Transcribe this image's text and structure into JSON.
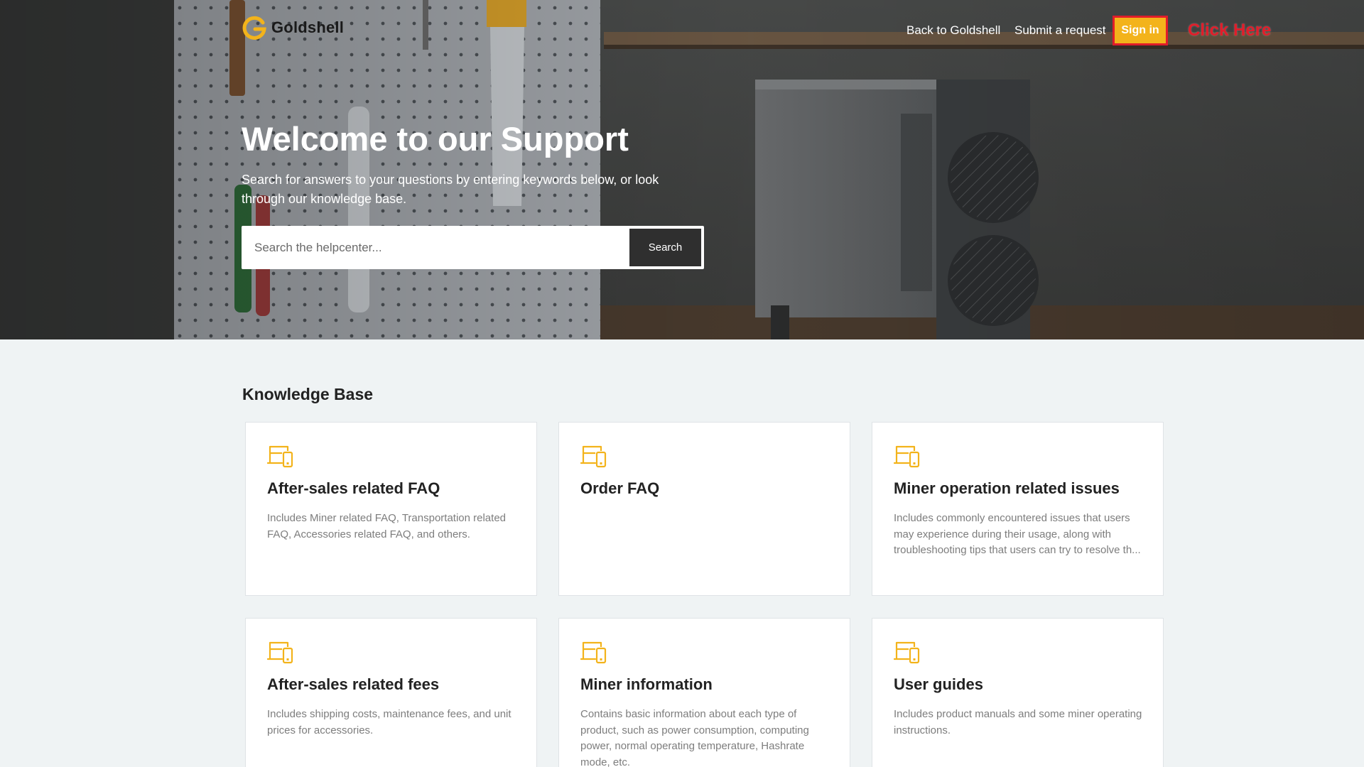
{
  "brand": {
    "name": "Goldshell",
    "accent_color": "#f3b31b",
    "logo_icon": "goldshell-g-icon"
  },
  "nav": {
    "back_label": "Back to Goldshell",
    "submit_label": "Submit a request",
    "signin_label": "Sign in",
    "annotation": "Click Here",
    "annotation_color": "#e11d2a"
  },
  "hero": {
    "title": "Welcome to our Support",
    "subtitle": "Search for answers to your questions by entering keywords below, or look through our knowledge base.",
    "search_placeholder": "Search the helpcenter...",
    "search_button": "Search"
  },
  "knowledge_base": {
    "title": "Knowledge Base",
    "card_icon": "devices-icon",
    "cards": [
      {
        "title": "After-sales related FAQ",
        "description": "Includes Miner related FAQ, Transportation related FAQ, Accessories related FAQ, and others."
      },
      {
        "title": "Order FAQ",
        "description": ""
      },
      {
        "title": "Miner operation related issues",
        "description": "Includes commonly encountered issues that users may experience during their usage, along with troubleshooting tips that users can try to resolve th..."
      },
      {
        "title": "After-sales related fees",
        "description": "Includes shipping costs, maintenance fees, and unit prices for accessories."
      },
      {
        "title": "Miner information",
        "description": "Contains basic information about each type of product, such as power consumption, computing power, normal operating temperature, Hashrate mode, etc."
      },
      {
        "title": "User guides",
        "description": "Includes product manuals and some miner operating instructions."
      }
    ]
  }
}
